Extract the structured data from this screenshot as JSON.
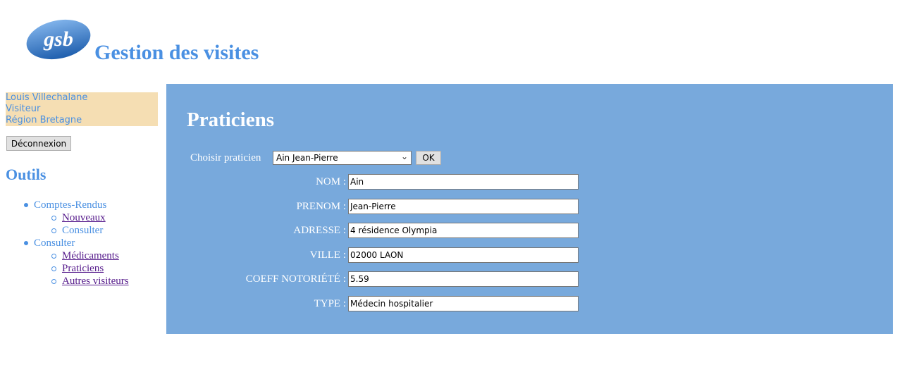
{
  "header": {
    "logo_text": "gsb",
    "title": "Gestion des visites"
  },
  "user": {
    "name": "Louis Villechalane",
    "role": "Visiteur",
    "region": "Région Bretagne"
  },
  "logout_label": "Déconnexion",
  "sidebar": {
    "title": "Outils",
    "groups": [
      {
        "label": "Comptes-Rendus",
        "items": [
          {
            "label": "Nouveaux",
            "link": true
          },
          {
            "label": "Consulter",
            "link": false
          }
        ]
      },
      {
        "label": "Consulter",
        "items": [
          {
            "label": "Médicaments",
            "link": true
          },
          {
            "label": "Praticiens",
            "link": true
          },
          {
            "label": "Autres visiteurs",
            "link": true
          }
        ]
      }
    ]
  },
  "main": {
    "title": "Praticiens",
    "choose_label": "Choisir praticien",
    "selected_praticien": "Ain Jean-Pierre",
    "ok_label": "OK",
    "fields": [
      {
        "label": "NOM :",
        "value": "Ain"
      },
      {
        "label": "PRENOM :",
        "value": "Jean-Pierre"
      },
      {
        "label": "ADRESSE :",
        "value": "4 résidence Olympia"
      },
      {
        "label": "VILLE :",
        "value": "02000 LAON"
      },
      {
        "label": "COEFF NOTORIÉTÉ :",
        "value": "5.59"
      },
      {
        "label": "TYPE :",
        "value": "Médecin hospitalier"
      }
    ]
  },
  "colors": {
    "accent": "#4a90e2",
    "panel": "#78a9dc",
    "user_box": "#f5deb3",
    "visited_link": "#551a8b"
  }
}
